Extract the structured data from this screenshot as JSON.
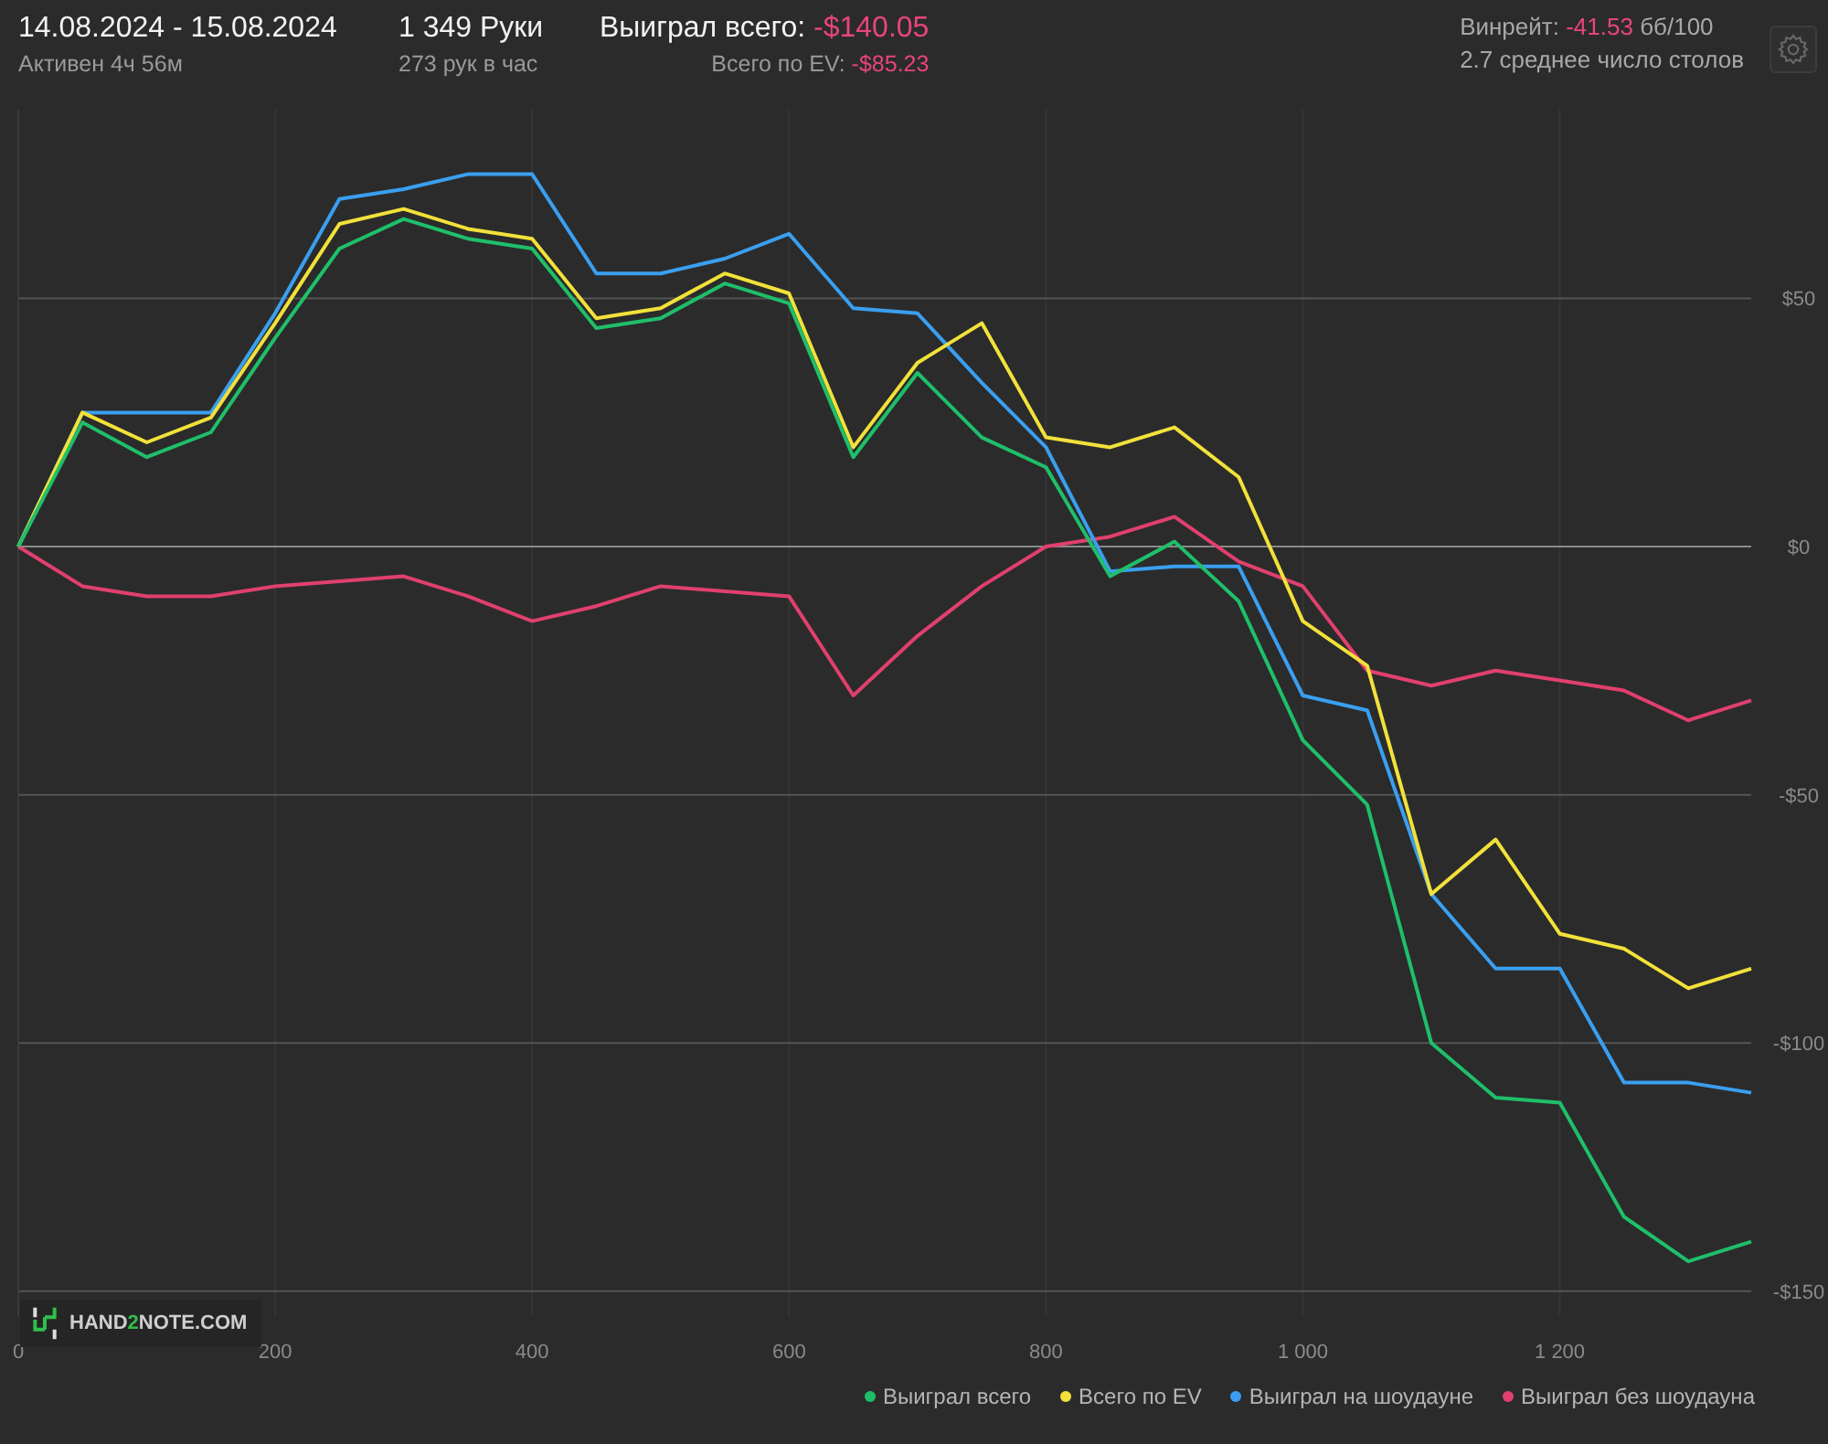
{
  "header": {
    "date_range": "14.08.2024 - 15.08.2024",
    "active_time": "Активен 4ч 56м",
    "hands": "1 349 Руки",
    "hands_per_hour": "273 рук в час",
    "won_total": {
      "label": "Выиграл всего:",
      "value": "-$140.05"
    },
    "ev_total": {
      "label": "Всего по EV:",
      "value": "-$85.23"
    },
    "winrate": {
      "label": "Винрейт:",
      "value": "-41.53",
      "unit": "бб/100"
    },
    "avg_tables": "2.7 среднее число столов"
  },
  "logo": {
    "before": "HAND",
    "accent": "2",
    "after": "NOTE.COM"
  },
  "chart": {
    "chart_data": {
      "type": "line",
      "x": [
        0,
        50,
        100,
        150,
        200,
        250,
        300,
        350,
        400,
        450,
        500,
        550,
        600,
        650,
        700,
        750,
        800,
        850,
        900,
        950,
        1000,
        1050,
        1100,
        1150,
        1200,
        1250,
        1300,
        1349
      ],
      "series": [
        {
          "name": "Выиграл всего",
          "color": "#1fbf6a",
          "values": [
            0,
            25,
            18,
            23,
            42,
            60,
            66,
            62,
            60,
            44,
            46,
            53,
            49,
            18,
            35,
            22,
            16,
            -6,
            1,
            -11,
            -39,
            -52,
            -100,
            -111,
            -112,
            -135,
            -144,
            -140
          ]
        },
        {
          "name": "Всего по EV",
          "color": "#f2e13a",
          "values": [
            0,
            27,
            21,
            26,
            45,
            65,
            68,
            64,
            62,
            46,
            48,
            55,
            51,
            20,
            37,
            45,
            22,
            20,
            24,
            14,
            -15,
            -24,
            -70,
            -59,
            -78,
            -81,
            -89,
            -85
          ]
        },
        {
          "name": "Выиграл на шоудауне",
          "color": "#3a9ff0",
          "values": [
            0,
            27,
            27,
            27,
            47,
            70,
            72,
            75,
            75,
            55,
            55,
            58,
            63,
            48,
            47,
            33,
            20,
            -5,
            -4,
            -4,
            -30,
            -33,
            -70,
            -85,
            -85,
            -108,
            -108,
            -110
          ]
        },
        {
          "name": "Выиграл без шоудауна",
          "color": "#e0406e",
          "values": [
            0,
            -8,
            -10,
            -10,
            -8,
            -7,
            -6,
            -10,
            -15,
            -12,
            -8,
            -9,
            -10,
            -30,
            -18,
            -8,
            0,
            2,
            6,
            -3,
            -8,
            -25,
            -28,
            -25,
            -27,
            -29,
            -35,
            -31
          ]
        }
      ],
      "grid": true,
      "xlim": [
        0,
        1349
      ],
      "ylim": [
        -155,
        88
      ],
      "xticks": [
        0,
        200,
        400,
        600,
        800,
        {
          "value": 1000,
          "label": "1 000"
        },
        {
          "value": 1200,
          "label": "1 200"
        }
      ],
      "yticks": [
        {
          "value": 50,
          "label": "$50"
        },
        {
          "value": 0,
          "label": "$0"
        },
        {
          "value": -50,
          "label": "-$50"
        },
        {
          "value": -100,
          "label": "-$100"
        },
        {
          "value": -150,
          "label": "-$150"
        }
      ]
    }
  }
}
